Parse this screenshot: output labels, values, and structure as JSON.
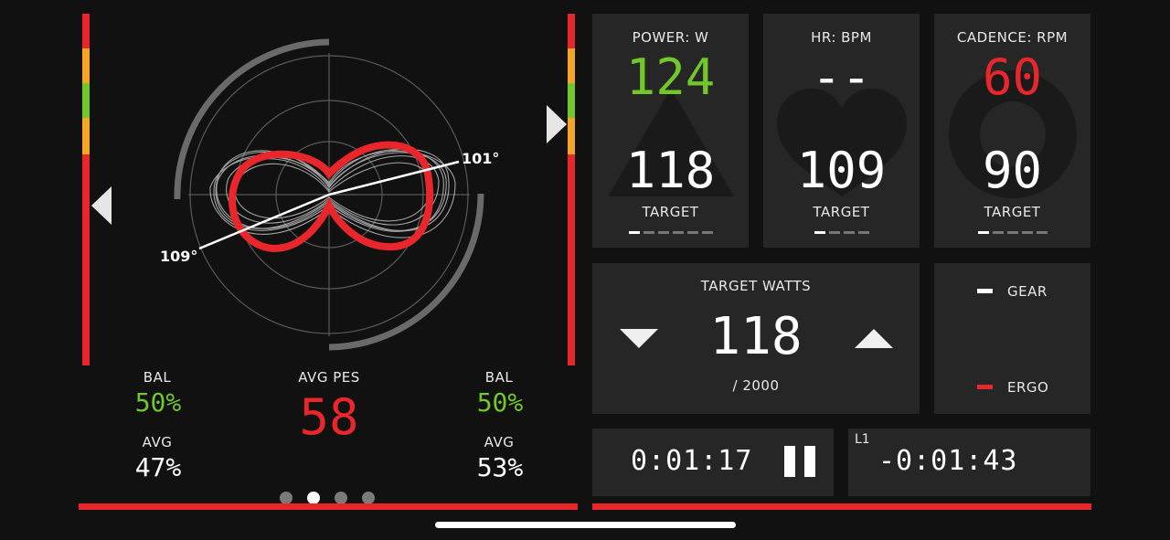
{
  "colors": {
    "red": "#e8262b",
    "green": "#72c72a",
    "orange": "#f5a623",
    "panel": "#262626",
    "background": "#111111"
  },
  "left": {
    "polar": {
      "angle_right": "101°",
      "angle_left": "109°"
    },
    "bal_left_label": "BAL",
    "bal_left_value": "50%",
    "avg_left_label": "AVG",
    "avg_left_value": "47%",
    "pes_label": "AVG PES",
    "pes_value": "58",
    "bal_right_label": "BAL",
    "bal_right_value": "50%",
    "avg_right_label": "AVG",
    "avg_right_value": "53%",
    "page_dots": 4,
    "active_dot": 1
  },
  "metrics": {
    "power": {
      "label": "POWER: W",
      "value": "124",
      "target": "118",
      "target_label": "TARGET"
    },
    "hr": {
      "label": "HR: BPM",
      "value": "--",
      "target": "109",
      "target_label": "TARGET"
    },
    "cadence": {
      "label": "CADENCE: RPM",
      "value": "60",
      "target": "90",
      "target_label": "TARGET"
    }
  },
  "target_watts": {
    "label": "TARGET WATTS",
    "value": "118",
    "max": "/ 2000"
  },
  "mode": {
    "gear_label": "GEAR",
    "ergo_label": "ERGO"
  },
  "timer": {
    "elapsed": "0:01:17",
    "lap_label": "L1",
    "lap_remaining": "-0:01:43"
  }
}
